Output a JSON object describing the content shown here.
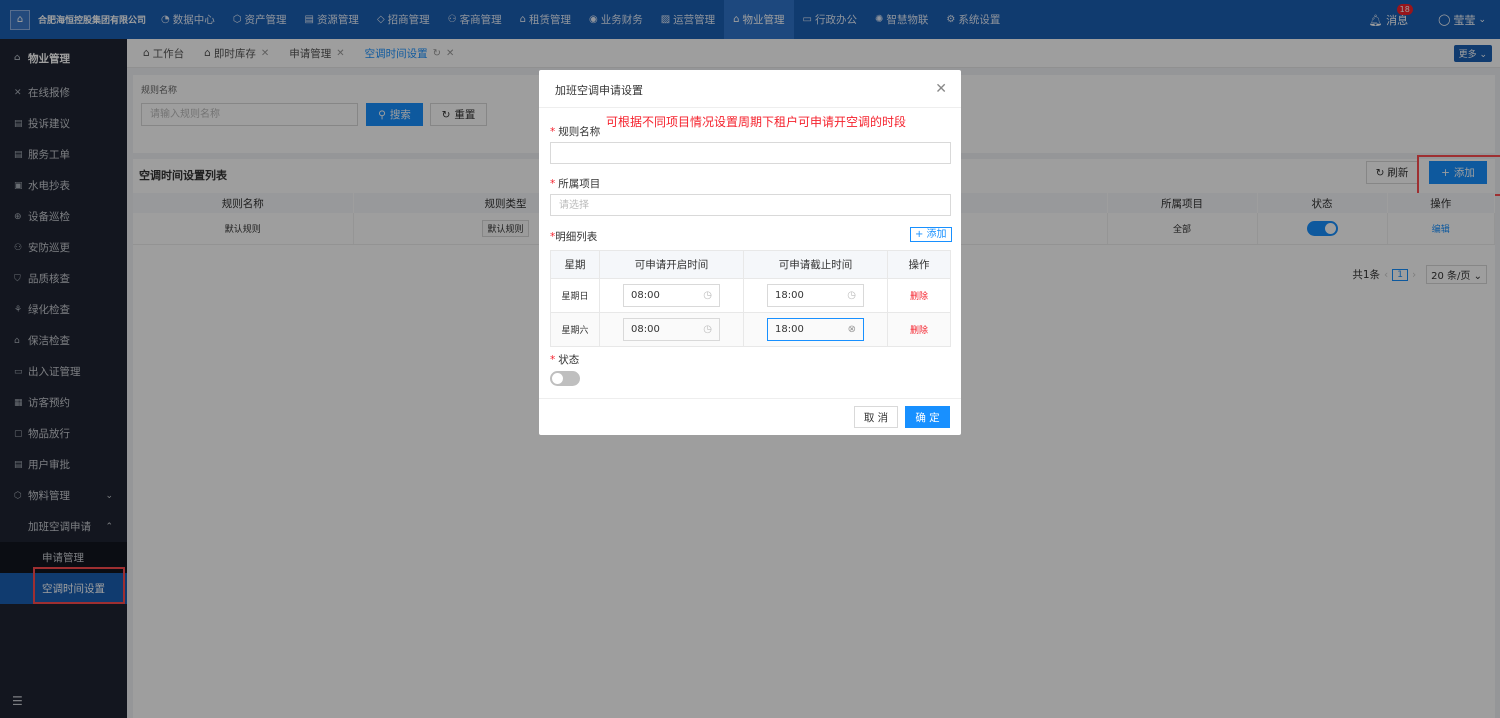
{
  "header": {
    "company": "合肥海恒控股集团有限公司",
    "nav": [
      {
        "label": "数据中心",
        "icon": "◔"
      },
      {
        "label": "资产管理",
        "icon": "⬡"
      },
      {
        "label": "资源管理",
        "icon": "▤"
      },
      {
        "label": "招商管理",
        "icon": "◇"
      },
      {
        "label": "客商管理",
        "icon": "⚇"
      },
      {
        "label": "租赁管理",
        "icon": "⌂"
      },
      {
        "label": "业务财务",
        "icon": "◉"
      },
      {
        "label": "运营管理",
        "icon": "▨"
      },
      {
        "label": "物业管理",
        "icon": "⌂"
      },
      {
        "label": "行政办公",
        "icon": "▭"
      },
      {
        "label": "智慧物联",
        "icon": "✺"
      },
      {
        "label": "系统设置",
        "icon": "⚙"
      }
    ],
    "messages_label": "消息",
    "messages_count": "18",
    "user_name": "莹莹"
  },
  "sidebar": {
    "title": "物业管理",
    "items": [
      "在线报修",
      "投诉建议",
      "服务工单",
      "水电抄表",
      "设备巡检",
      "安防巡更",
      "品质核查",
      "绿化检查",
      "保洁检查",
      "出入证管理",
      "访客预约",
      "物品放行",
      "用户审批",
      "物料管理"
    ],
    "group": "加班空调申请",
    "sub_items": [
      "申请管理",
      "空调时间设置"
    ]
  },
  "tabs": [
    "工作台",
    "即时库存",
    "申请管理",
    "空调时间设置"
  ],
  "more_label": "更多",
  "search": {
    "label": "规则名称",
    "placeholder": "请输入规则名称",
    "search_label": "搜索",
    "reset_label": "重置"
  },
  "list": {
    "title": "空调时间设置列表",
    "refresh_label": "刷新",
    "add_label": "添加",
    "columns": [
      "规则名称",
      "规则类型",
      "所属项目",
      "状态",
      "操作"
    ],
    "rows": [
      {
        "name": "默认规则",
        "type": "默认规则",
        "project": "全部",
        "action": "编辑"
      }
    ],
    "pager": {
      "total": "共1条",
      "current": "1",
      "size": "20 条/页"
    }
  },
  "dialog": {
    "title": "加班空调申请设置",
    "annotation": "可根据不同项目情况设置周期下租户可申请开空调的时段",
    "rule_name_label": "规则名称",
    "project_label": "所属项目",
    "project_placeholder": "请选择",
    "detail_label": "明细列表",
    "detail_add": "+ 添加",
    "detail_columns": [
      "星期",
      "可申请开启时间",
      "可申请截止时间",
      "操作"
    ],
    "detail_rows": [
      {
        "day": "星期日",
        "start": "08:00",
        "end": "18:00",
        "action": "删除"
      },
      {
        "day": "星期六",
        "start": "08:00",
        "end": "18:00",
        "action": "删除"
      }
    ],
    "status_label": "状态",
    "cancel_label": "取 消",
    "ok_label": "确 定"
  },
  "colors": {
    "primary": "#1890ff",
    "header": "#1a5fb4",
    "sidebar": "#1f2533",
    "danger": "#f5222d"
  }
}
